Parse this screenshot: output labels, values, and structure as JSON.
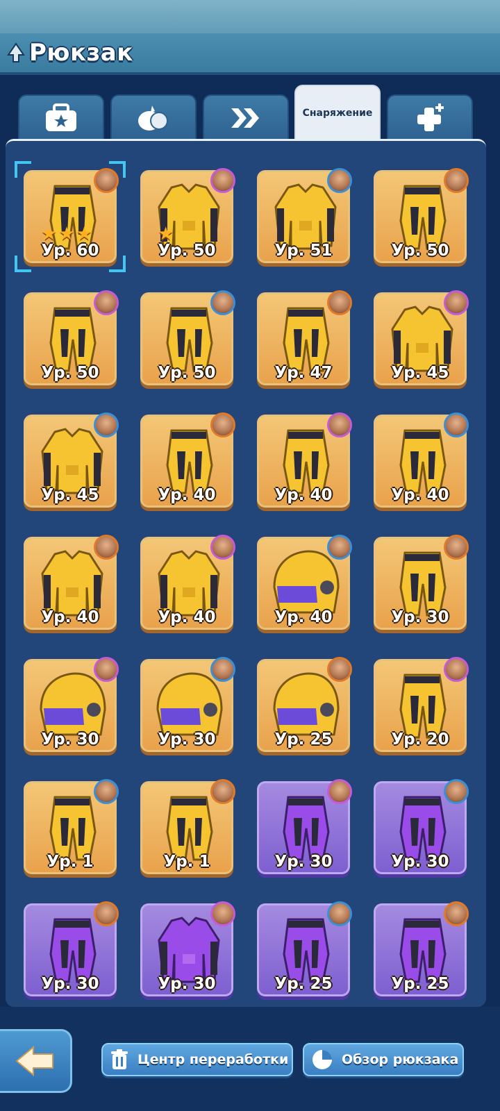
{
  "header": {
    "title": "Рюкзак"
  },
  "tabs": [
    {
      "icon": "treasure-bag-icon",
      "active": false
    },
    {
      "icon": "food-icon",
      "active": false
    },
    {
      "icon": "double-arrow-icon",
      "active": false
    },
    {
      "label": "Снаряжение",
      "active": true
    },
    {
      "icon": "plus-boost-icon",
      "active": false
    }
  ],
  "items": [
    {
      "type": "pants",
      "rarity": "gold",
      "level": "Ур. 60",
      "stars": 3,
      "selected": true
    },
    {
      "type": "jacket",
      "rarity": "gold",
      "level": "Ур. 50",
      "stars": 1
    },
    {
      "type": "jacket",
      "rarity": "gold",
      "level": "Ур. 51"
    },
    {
      "type": "pants",
      "rarity": "gold",
      "level": "Ур. 50"
    },
    {
      "type": "pants",
      "rarity": "gold",
      "level": "Ур. 50"
    },
    {
      "type": "pants",
      "rarity": "gold",
      "level": "Ур. 50"
    },
    {
      "type": "pants",
      "rarity": "gold",
      "level": "Ур. 47"
    },
    {
      "type": "jacket",
      "rarity": "gold",
      "level": "Ур. 45"
    },
    {
      "type": "jacket",
      "rarity": "gold",
      "level": "Ур. 45"
    },
    {
      "type": "pants",
      "rarity": "gold",
      "level": "Ур. 40"
    },
    {
      "type": "pants",
      "rarity": "gold",
      "level": "Ур. 40"
    },
    {
      "type": "pants",
      "rarity": "gold",
      "level": "Ур. 40"
    },
    {
      "type": "jacket",
      "rarity": "gold",
      "level": "Ур. 40"
    },
    {
      "type": "jacket",
      "rarity": "gold",
      "level": "Ур. 40"
    },
    {
      "type": "helmet",
      "rarity": "gold",
      "level": "Ур. 40"
    },
    {
      "type": "pants",
      "rarity": "gold",
      "level": "Ур. 30"
    },
    {
      "type": "helmet",
      "rarity": "gold",
      "level": "Ур. 30"
    },
    {
      "type": "helmet",
      "rarity": "gold",
      "level": "Ур. 30"
    },
    {
      "type": "helmet",
      "rarity": "gold",
      "level": "Ур. 25"
    },
    {
      "type": "pants",
      "rarity": "gold",
      "level": "Ур. 20"
    },
    {
      "type": "pants",
      "rarity": "gold",
      "level": "Ур. 1"
    },
    {
      "type": "pants",
      "rarity": "gold",
      "level": "Ур. 1"
    },
    {
      "type": "pants",
      "rarity": "purple",
      "level": "Ур. 30"
    },
    {
      "type": "pants",
      "rarity": "purple",
      "level": "Ур. 30"
    },
    {
      "type": "pants",
      "rarity": "purple",
      "level": "Ур. 30"
    },
    {
      "type": "jacket",
      "rarity": "purple",
      "level": "Ур. 30"
    },
    {
      "type": "pants",
      "rarity": "purple",
      "level": "Ур. 25"
    },
    {
      "type": "pants",
      "rarity": "purple",
      "level": "Ур. 25"
    }
  ],
  "footer": {
    "recycle_label": "Центр переработки",
    "overview_label": "Обзор рюкзака"
  },
  "colors": {
    "accent": "#43c6f0",
    "gold": "#e9a24b",
    "purple": "#7e5fd0"
  }
}
